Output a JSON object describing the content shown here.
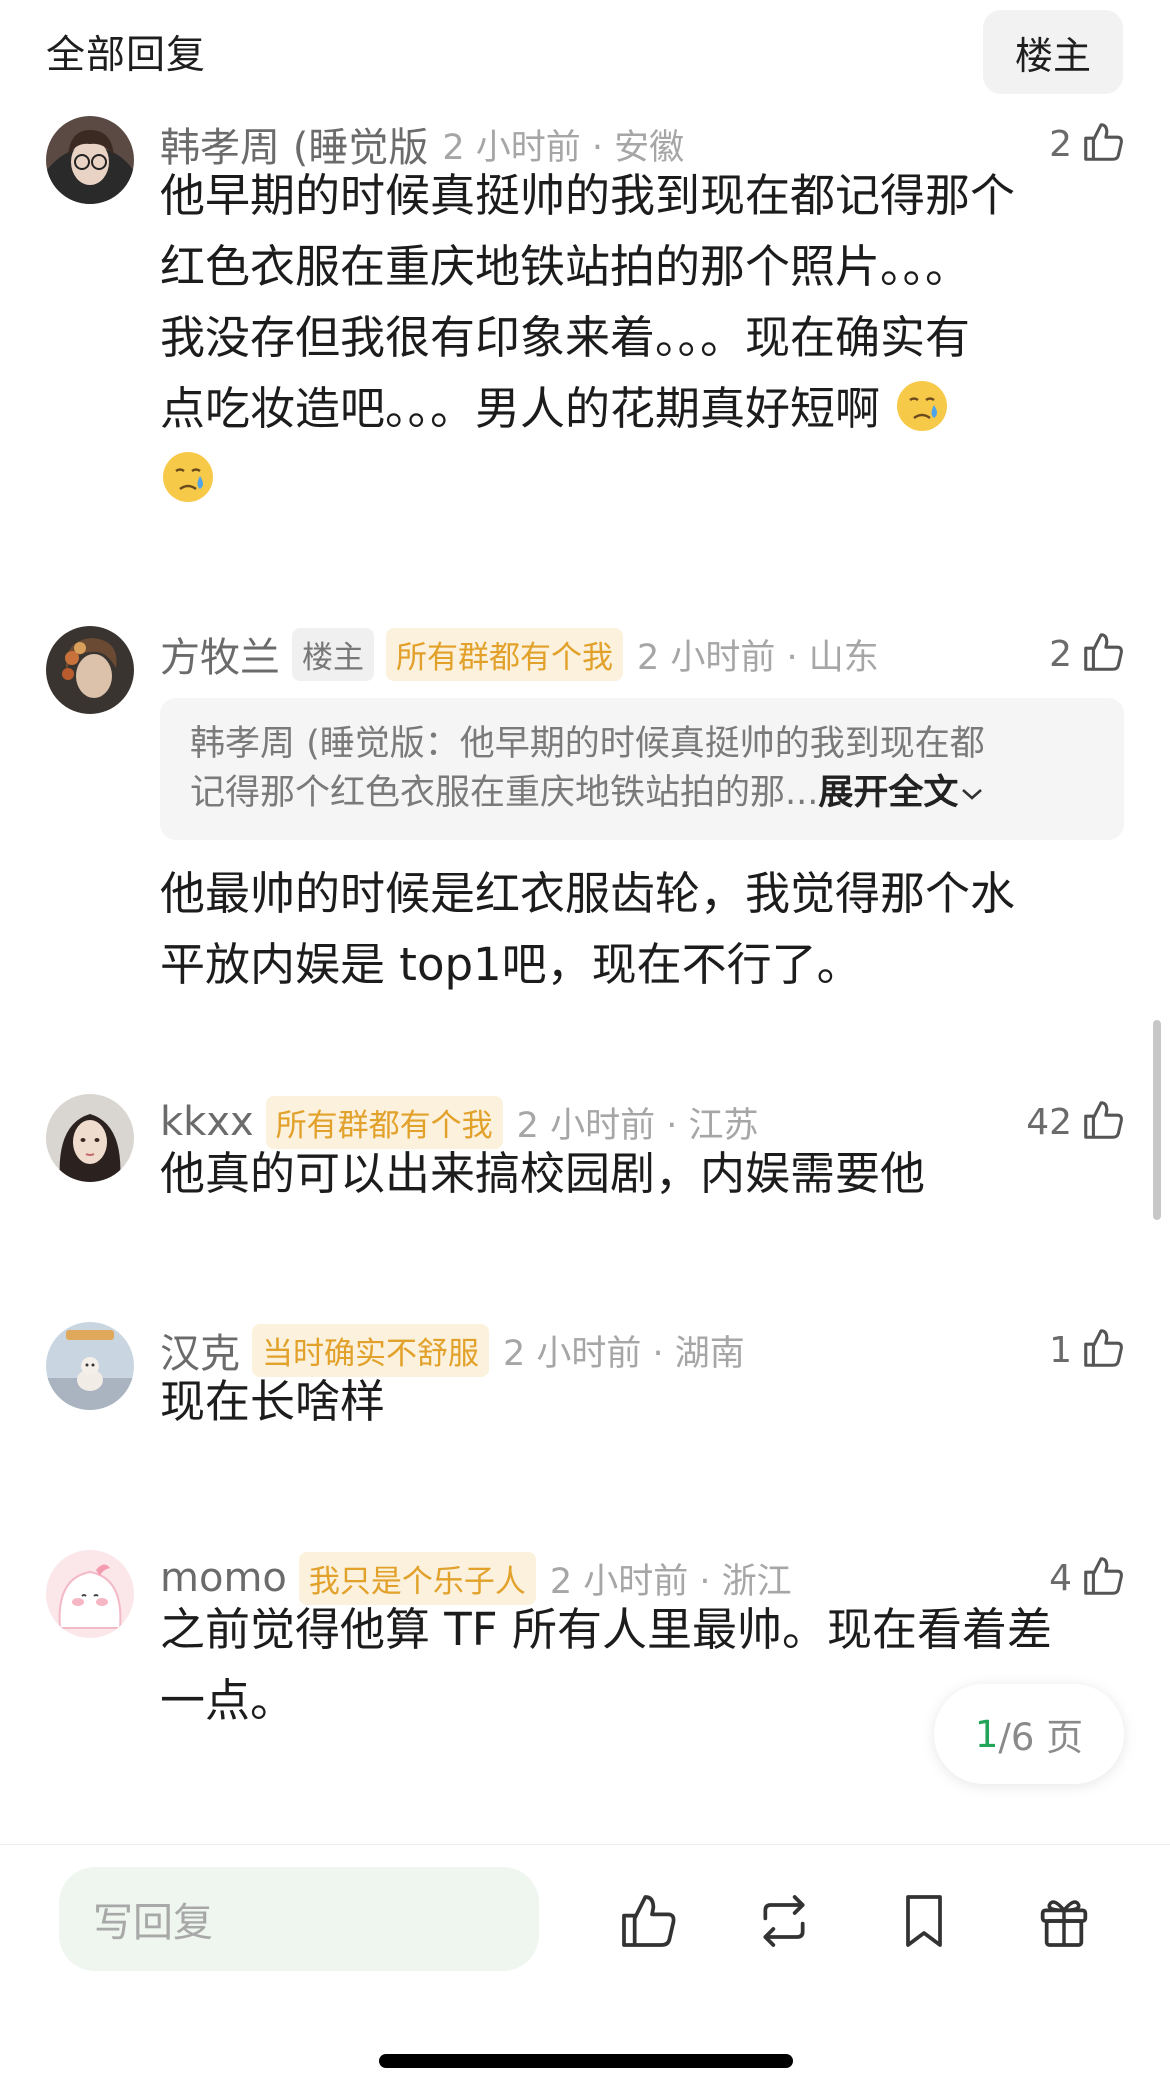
{
  "header": {
    "title": "全部回复",
    "filter_op": "楼主"
  },
  "comments": [
    {
      "user": "韩孝周 (睡觉版",
      "time": "2 小时前 · 安徽",
      "likes": "2",
      "text_lines": [
        "他早期的时候真挺帅的我到现在都记得那个",
        "红色衣服在重庆地铁站拍的那个照片。。。",
        "我没存但我很有印象来着。。。现在确实有",
        "点吃妆造吧。。。男人的花期真好短啊"
      ],
      "emojis": [
        "crying-face",
        "crying-face"
      ]
    },
    {
      "user": "方牧兰",
      "badge_op": "楼主",
      "badge_fan": "所有群都有个我",
      "time": "2 小时前 · 山东",
      "likes": "2",
      "quote_line1": "韩孝周 (睡觉版：他早期的时候真挺帅的我到现在都",
      "quote_line2": "记得那个红色衣服在重庆地铁站拍的那...",
      "quote_expand": "展开全文",
      "text_lines": [
        "他最帅的时候是红衣服齿轮，我觉得那个水",
        "平放内娱是 top1吧，现在不行了。"
      ]
    },
    {
      "user": "kkxx",
      "badge_fan": "所有群都有个我",
      "time": "2 小时前 · 江苏",
      "likes": "42",
      "text_lines": [
        "他真的可以出来搞校园剧，内娱需要他"
      ]
    },
    {
      "user": "汉克",
      "badge_fan": "当时确实不舒服",
      "time": "2 小时前 · 湖南",
      "likes": "1",
      "text_lines": [
        "现在长啥样"
      ]
    },
    {
      "user": "momo",
      "badge_fan": "我只是个乐子人",
      "time": "2 小时前 · 浙江",
      "likes": "4",
      "text_lines": [
        "之前觉得他算 TF 所有人里最帅。现在看着差",
        "一点。"
      ]
    }
  ],
  "pager": {
    "current": "1",
    "total_suffix": "/6 页"
  },
  "bottom_bar": {
    "reply_placeholder": "写回复",
    "icons": [
      "like-icon",
      "repost-icon",
      "bookmark-icon",
      "gift-icon"
    ]
  },
  "colors": {
    "accent_green": "#22a559",
    "badge_gold": "#e2a12a",
    "badge_gold_bg": "#fbf1dc"
  }
}
